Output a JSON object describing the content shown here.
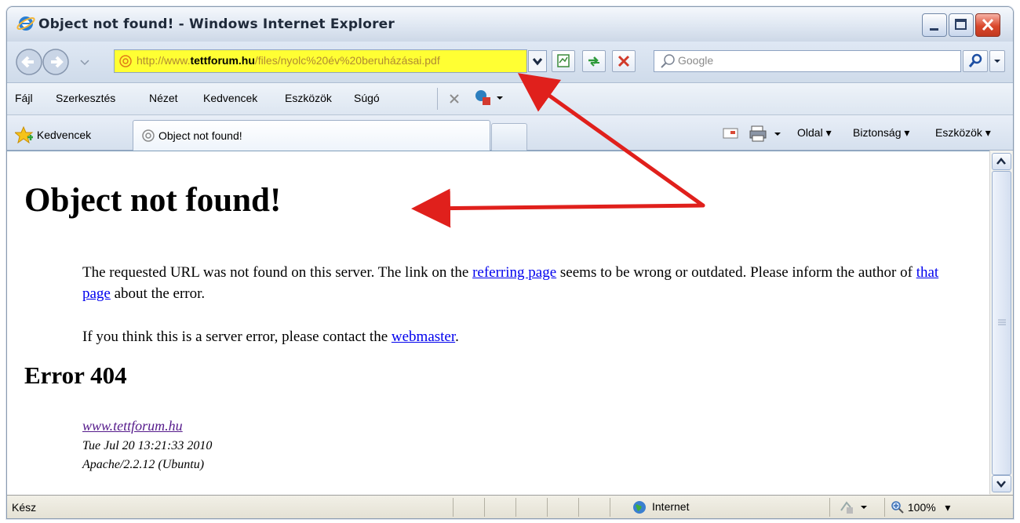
{
  "window": {
    "title": "Object not found! - Windows Internet Explorer"
  },
  "address": {
    "url_prefix": "http://www.",
    "url_domain": "tettforum.hu",
    "url_path": "/files/nyolc%20év%20beruházásai.pdf"
  },
  "search": {
    "placeholder": "Google"
  },
  "menu": {
    "items": [
      "Fájl",
      "Szerkesztés",
      "Nézet",
      "Kedvencek",
      "Eszközök",
      "Súgó"
    ]
  },
  "favorites": {
    "label": "Kedvencek"
  },
  "tab": {
    "label": "Object not found!"
  },
  "command_bar": {
    "page": "Oldal",
    "safety": "Biztonság",
    "tools": "Eszközök"
  },
  "page": {
    "heading": "Object not found!",
    "para1_a": "The requested URL was not found on this server. The link on the ",
    "para1_link1": "referring page",
    "para1_b": " seems to be wrong or outdated. Please inform the author of ",
    "para1_link2": "that page",
    "para1_c": " about the error.",
    "para2_a": "If you think this is a server error, please contact the ",
    "para2_link": "webmaster",
    "para2_b": ".",
    "error_heading": "Error 404",
    "server_site": "www.tettforum.hu",
    "server_date": "Tue Jul 20 13:21:33 2010",
    "server_software": "Apache/2.2.12 (Ubuntu)"
  },
  "status": {
    "text": "Kész",
    "zone": "Internet",
    "zoom": "100%"
  },
  "colors": {
    "address_highlight": "#ffff33",
    "annotation_arrow": "#e0201c",
    "link": "#0000ee",
    "visited_link": "#551a8b"
  }
}
